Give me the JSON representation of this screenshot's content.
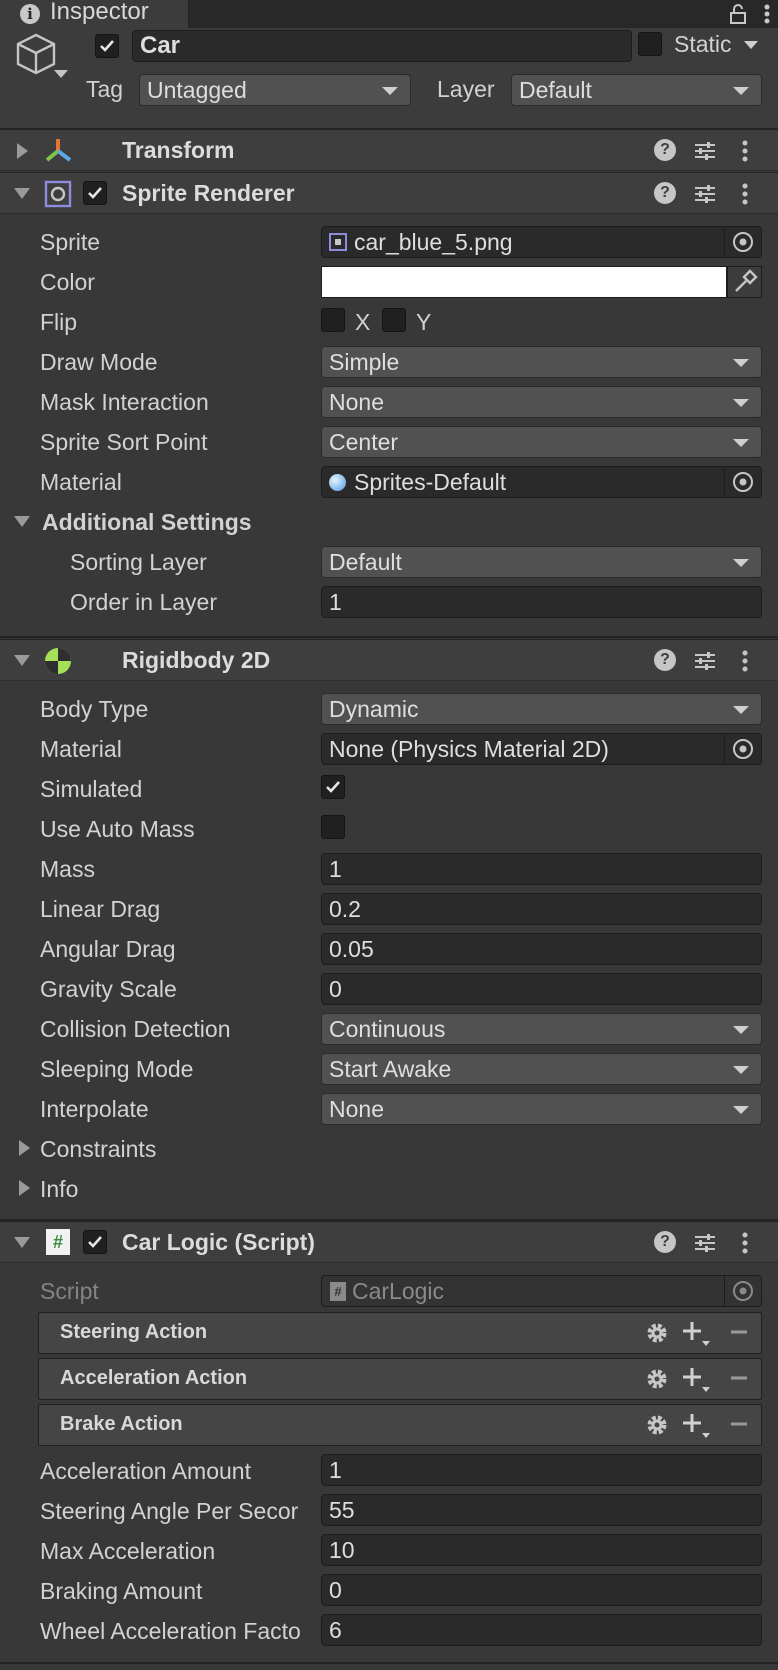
{
  "window": {
    "tab_title": "Inspector"
  },
  "header": {
    "object_name": "Car",
    "static_label": "Static",
    "tag_label": "Tag",
    "tag_value": "Untagged",
    "layer_label": "Layer",
    "layer_value": "Default"
  },
  "transform": {
    "title": "Transform"
  },
  "sprite_renderer": {
    "title": "Sprite Renderer",
    "sprite_label": "Sprite",
    "sprite_value": "car_blue_5.png",
    "color_label": "Color",
    "color_value": "#ffffff",
    "flip_label": "Flip",
    "flip_x": "X",
    "flip_y": "Y",
    "draw_mode_label": "Draw Mode",
    "draw_mode_value": "Simple",
    "mask_label": "Mask Interaction",
    "mask_value": "None",
    "sort_point_label": "Sprite Sort Point",
    "sort_point_value": "Center",
    "material_label": "Material",
    "material_value": "Sprites-Default",
    "additional_label": "Additional Settings",
    "sorting_layer_label": "Sorting Layer",
    "sorting_layer_value": "Default",
    "order_label": "Order in Layer",
    "order_value": "1"
  },
  "rigidbody": {
    "title": "Rigidbody 2D",
    "body_type_label": "Body Type",
    "body_type_value": "Dynamic",
    "material_label": "Material",
    "material_value": "None (Physics Material 2D)",
    "simulated_label": "Simulated",
    "auto_mass_label": "Use Auto Mass",
    "mass_label": "Mass",
    "mass_value": "1",
    "linear_drag_label": "Linear Drag",
    "linear_drag_value": "0.2",
    "angular_drag_label": "Angular Drag",
    "angular_drag_value": "0.05",
    "gravity_label": "Gravity Scale",
    "gravity_value": "0",
    "collision_label": "Collision Detection",
    "collision_value": "Continuous",
    "sleeping_label": "Sleeping Mode",
    "sleeping_value": "Start Awake",
    "interpolate_label": "Interpolate",
    "interpolate_value": "None",
    "constraints_label": "Constraints",
    "info_label": "Info"
  },
  "car_logic": {
    "title": "Car Logic (Script)",
    "script_label": "Script",
    "script_value": "CarLogic",
    "steering_action": "Steering Action",
    "acceleration_action": "Acceleration Action",
    "brake_action": "Brake Action",
    "accel_amount_label": "Acceleration Amount",
    "accel_amount_value": "1",
    "steer_angle_label": "Steering Angle Per Secor",
    "steer_angle_value": "55",
    "max_accel_label": "Max Acceleration",
    "max_accel_value": "10",
    "braking_label": "Braking Amount",
    "braking_value": "0",
    "wheel_accel_label": "Wheel Acceleration Facto",
    "wheel_accel_value": "6"
  },
  "colors": {
    "panel_bg": "#383838",
    "header_bg": "#3e3e3e",
    "field_bg": "#2a2a2a",
    "dropdown_bg": "#515151",
    "transform_icon": [
      "#e8733a",
      "#7fc548",
      "#5aa8e8"
    ],
    "rigidbody_icon": "#a6e05a",
    "script_icon": "#4caf50"
  }
}
